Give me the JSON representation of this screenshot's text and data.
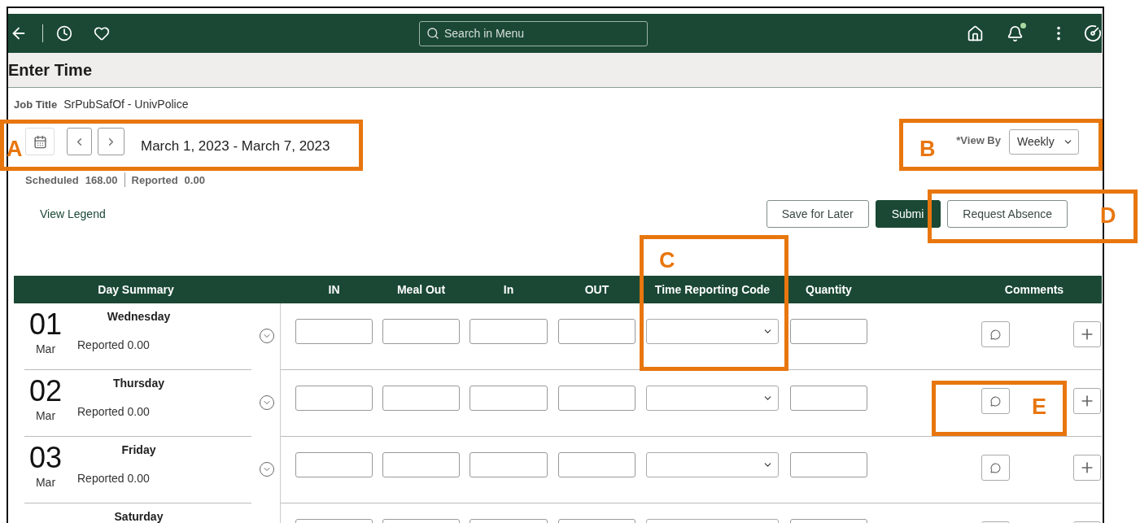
{
  "nav": {
    "search": {
      "placeholder": "Search in Menu"
    }
  },
  "page_title": "Enter Time",
  "job": {
    "label": "Job Title",
    "value": "SrPubSafOf - UnivPolice"
  },
  "period": {
    "range": "March 1, 2023 - March 7, 2023"
  },
  "view_by": {
    "label": "*View By",
    "value": "Weekly"
  },
  "totals": [
    {
      "label": "Scheduled",
      "value": "168.00"
    },
    {
      "label": "Reported",
      "value": "0.00"
    }
  ],
  "legend_link": "View Legend",
  "buttons": [
    {
      "label": "Save for Later",
      "kind": "secondary"
    },
    {
      "label": "Submi",
      "kind": "primary"
    },
    {
      "label": "Request Absence",
      "kind": "secondary"
    }
  ],
  "table": {
    "summary_header": "Day Summary",
    "columns": [
      {
        "label": "IN",
        "kind": "time"
      },
      {
        "label": "Meal Out",
        "kind": "time"
      },
      {
        "label": "In",
        "kind": "time"
      },
      {
        "label": "OUT",
        "kind": "time"
      },
      {
        "label": "Time Reporting Code",
        "kind": "code"
      },
      {
        "label": "Quantity",
        "kind": "quantity"
      },
      {
        "label": "Comments",
        "kind": "comments"
      }
    ],
    "rows": [
      {
        "day": "01",
        "month": "Mar",
        "weekday": "Wednesday",
        "reported": "Reported 0.00"
      },
      {
        "day": "02",
        "month": "Mar",
        "weekday": "Thursday",
        "reported": "Reported 0.00"
      },
      {
        "day": "03",
        "month": "Mar",
        "weekday": "Friday",
        "reported": "Reported 0.00"
      },
      {
        "weekday": "Saturday"
      }
    ]
  },
  "callouts": [
    {
      "label": "A"
    },
    {
      "label": "B"
    },
    {
      "label": "C"
    },
    {
      "label": "D"
    },
    {
      "label": "E"
    }
  ]
}
